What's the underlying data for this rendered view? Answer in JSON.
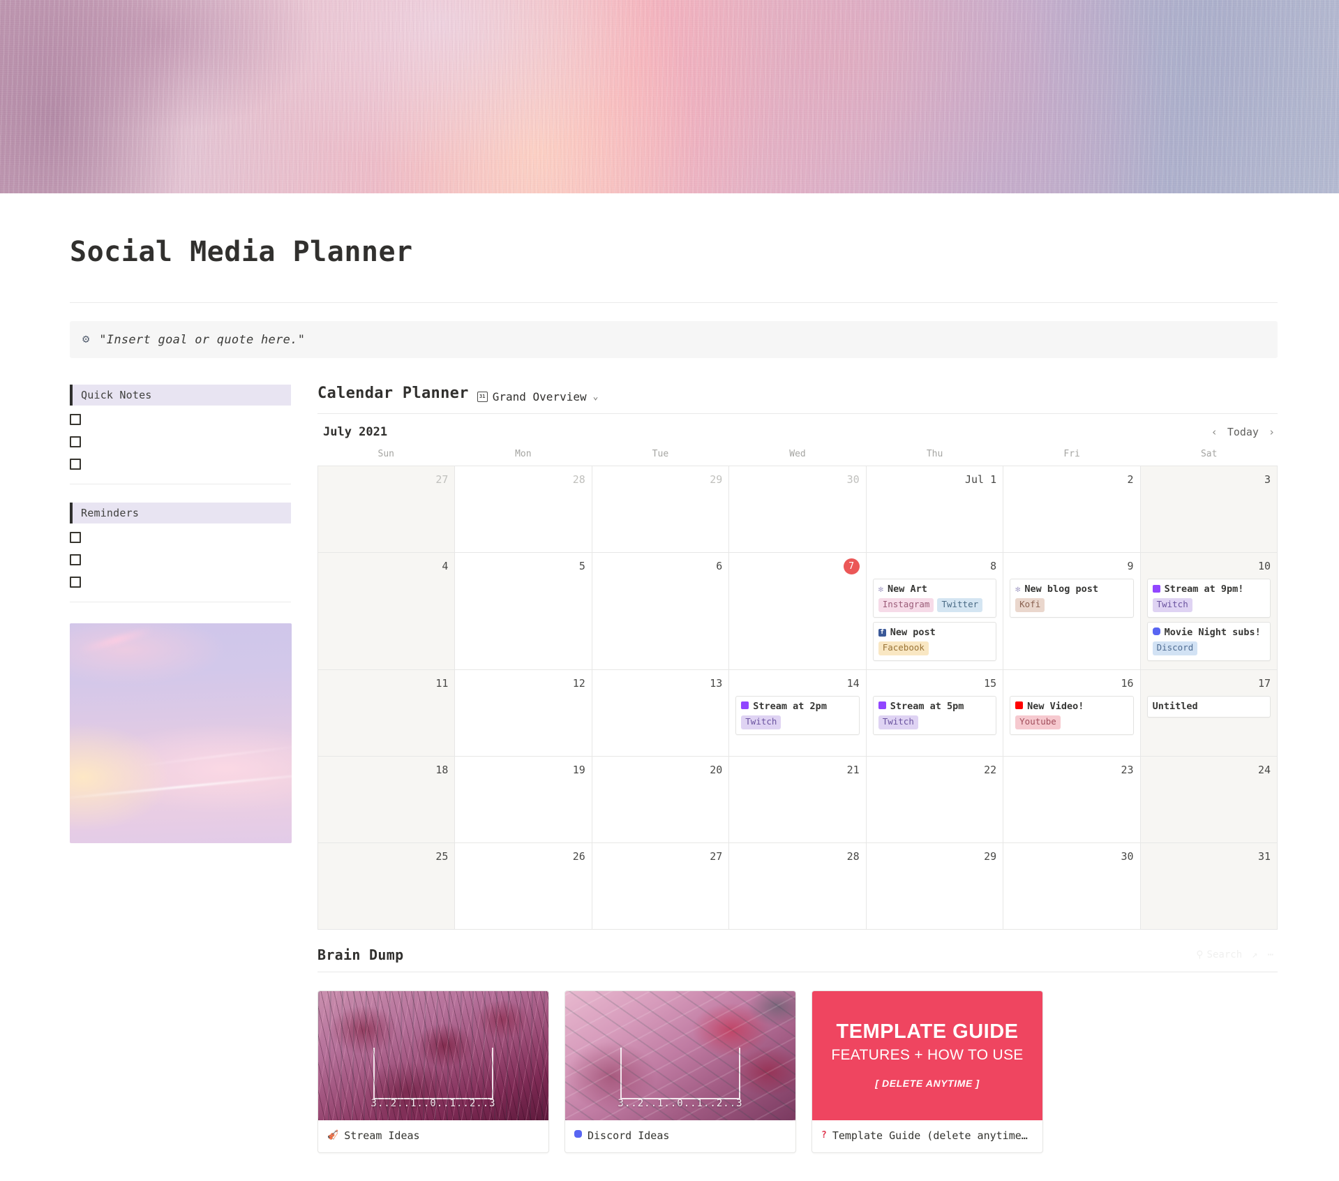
{
  "page": {
    "title": "Social Media Planner",
    "banner_alt": "pink lavender watercolor banner"
  },
  "callout": {
    "icon": "gear-flower-icon",
    "icon_glyph": "⚙",
    "text": "\"Insert goal or quote here.\""
  },
  "sidebar": {
    "quick_notes": {
      "heading": "Quick Notes",
      "items": [
        "",
        "",
        ""
      ]
    },
    "reminders": {
      "heading": "Reminders",
      "items": [
        "",
        "",
        ""
      ]
    },
    "image_alt": "pastel sunset sky photo"
  },
  "calendar": {
    "heading": "Calendar Planner",
    "source_icon": "calendar-31-icon",
    "source_icon_glyph": "31",
    "source_label": "Grand Overview",
    "chevron": "⌄",
    "month_label": "July 2021",
    "nav": {
      "prev": "‹",
      "today": "Today",
      "next": "›"
    },
    "weekdays": [
      "Sun",
      "Mon",
      "Tue",
      "Wed",
      "Thu",
      "Fri",
      "Sat"
    ],
    "weeks": [
      [
        {
          "day": "27",
          "muted": true,
          "weekend": true,
          "today": false,
          "events": []
        },
        {
          "day": "28",
          "muted": true,
          "weekend": false,
          "today": false,
          "events": []
        },
        {
          "day": "29",
          "muted": true,
          "weekend": false,
          "today": false,
          "events": []
        },
        {
          "day": "30",
          "muted": true,
          "weekend": false,
          "today": false,
          "events": []
        },
        {
          "day": "Jul 1",
          "muted": false,
          "weekend": false,
          "today": false,
          "events": []
        },
        {
          "day": "2",
          "muted": false,
          "weekend": false,
          "today": false,
          "events": []
        },
        {
          "day": "3",
          "muted": false,
          "weekend": true,
          "today": false,
          "events": []
        }
      ],
      [
        {
          "day": "4",
          "muted": false,
          "weekend": true,
          "today": false,
          "events": []
        },
        {
          "day": "5",
          "muted": false,
          "weekend": false,
          "today": false,
          "events": []
        },
        {
          "day": "6",
          "muted": false,
          "weekend": false,
          "today": false,
          "events": []
        },
        {
          "day": "7",
          "muted": false,
          "weekend": false,
          "today": true,
          "events": []
        },
        {
          "day": "8",
          "muted": false,
          "weekend": false,
          "today": false,
          "events": [
            {
              "title": "New Art",
              "icon": "flower-icon",
              "tags": [
                {
                  "label": "Instagram",
                  "color": "instagram"
                },
                {
                  "label": "Twitter",
                  "color": "twitter"
                }
              ]
            },
            {
              "title": "New post",
              "icon": "facebook-icon",
              "tags": [
                {
                  "label": "Facebook",
                  "color": "facebook"
                }
              ]
            }
          ]
        },
        {
          "day": "9",
          "muted": false,
          "weekend": false,
          "today": false,
          "events": [
            {
              "title": "New blog post",
              "icon": "flower-icon",
              "tags": [
                {
                  "label": "Kofi",
                  "color": "kofi"
                }
              ]
            }
          ]
        },
        {
          "day": "10",
          "muted": false,
          "weekend": true,
          "today": false,
          "events": [
            {
              "title": "Stream at 9pm!",
              "icon": "twitch-icon",
              "tags": [
                {
                  "label": "Twitch",
                  "color": "twitch"
                }
              ]
            },
            {
              "title": "Movie Night subs!",
              "icon": "discord-icon",
              "tags": [
                {
                  "label": "Discord",
                  "color": "discord"
                }
              ]
            }
          ]
        }
      ],
      [
        {
          "day": "11",
          "muted": false,
          "weekend": true,
          "today": false,
          "events": []
        },
        {
          "day": "12",
          "muted": false,
          "weekend": false,
          "today": false,
          "events": []
        },
        {
          "day": "13",
          "muted": false,
          "weekend": false,
          "today": false,
          "events": []
        },
        {
          "day": "14",
          "muted": false,
          "weekend": false,
          "today": false,
          "events": [
            {
              "title": "Stream at 2pm",
              "icon": "twitch-icon",
              "tags": [
                {
                  "label": "Twitch",
                  "color": "twitch"
                }
              ]
            }
          ]
        },
        {
          "day": "15",
          "muted": false,
          "weekend": false,
          "today": false,
          "events": [
            {
              "title": "Stream at 5pm",
              "icon": "twitch-icon",
              "tags": [
                {
                  "label": "Twitch",
                  "color": "twitch"
                }
              ]
            }
          ]
        },
        {
          "day": "16",
          "muted": false,
          "weekend": false,
          "today": false,
          "events": [
            {
              "title": "New Video!",
              "icon": "youtube-icon",
              "tags": [
                {
                  "label": "Youtube",
                  "color": "youtube"
                }
              ]
            }
          ]
        },
        {
          "day": "17",
          "muted": false,
          "weekend": true,
          "today": false,
          "events": [
            {
              "title": "Untitled",
              "icon": "",
              "tags": []
            }
          ]
        }
      ],
      [
        {
          "day": "18",
          "muted": false,
          "weekend": true,
          "today": false,
          "events": []
        },
        {
          "day": "19",
          "muted": false,
          "weekend": false,
          "today": false,
          "events": []
        },
        {
          "day": "20",
          "muted": false,
          "weekend": false,
          "today": false,
          "events": []
        },
        {
          "day": "21",
          "muted": false,
          "weekend": false,
          "today": false,
          "events": []
        },
        {
          "day": "22",
          "muted": false,
          "weekend": false,
          "today": false,
          "events": []
        },
        {
          "day": "23",
          "muted": false,
          "weekend": false,
          "today": false,
          "events": []
        },
        {
          "day": "24",
          "muted": false,
          "weekend": true,
          "today": false,
          "events": []
        }
      ],
      [
        {
          "day": "25",
          "muted": false,
          "weekend": true,
          "today": false,
          "events": []
        },
        {
          "day": "26",
          "muted": false,
          "weekend": false,
          "today": false,
          "events": []
        },
        {
          "day": "27",
          "muted": false,
          "weekend": false,
          "today": false,
          "events": []
        },
        {
          "day": "28",
          "muted": false,
          "weekend": false,
          "today": false,
          "events": []
        },
        {
          "day": "29",
          "muted": false,
          "weekend": false,
          "today": false,
          "events": []
        },
        {
          "day": "30",
          "muted": false,
          "weekend": false,
          "today": false,
          "events": []
        },
        {
          "day": "31",
          "muted": false,
          "weekend": true,
          "today": false,
          "events": []
        }
      ]
    ]
  },
  "brain_dump": {
    "heading": "Brain Dump",
    "search_placeholder": "Search",
    "search_icon": "magnifier-icon",
    "expand_icon": "expand-icon",
    "more_icon": "ellipsis-icon",
    "cards": [
      {
        "title": "Stream Ideas",
        "icon": "violin-icon",
        "icon_glyph": "🎻",
        "image": "flowers",
        "overlay": "3..2..1..0..1..2..3"
      },
      {
        "title": "Discord Ideas",
        "icon": "discord-icon",
        "icon_glyph": "",
        "image": "desk",
        "overlay": "3..2..1..0..1..2..3"
      },
      {
        "title": "Template Guide (delete anytime…",
        "icon": "question-icon",
        "icon_glyph": "?",
        "image": "guide",
        "overlay": "",
        "guide": {
          "line1": "TEMPLATE GUIDE",
          "line2": "FEATURES + HOW TO USE",
          "line3": "[ DELETE ANYTIME ]"
        }
      }
    ]
  },
  "colors": {
    "accent_red": "#eb5757",
    "guide_bg": "#ef4560",
    "sidebar_heading_bg": "#e8e4f2",
    "weekend_bg": "#f7f6f3",
    "callout_bg": "#f6f6f6"
  }
}
